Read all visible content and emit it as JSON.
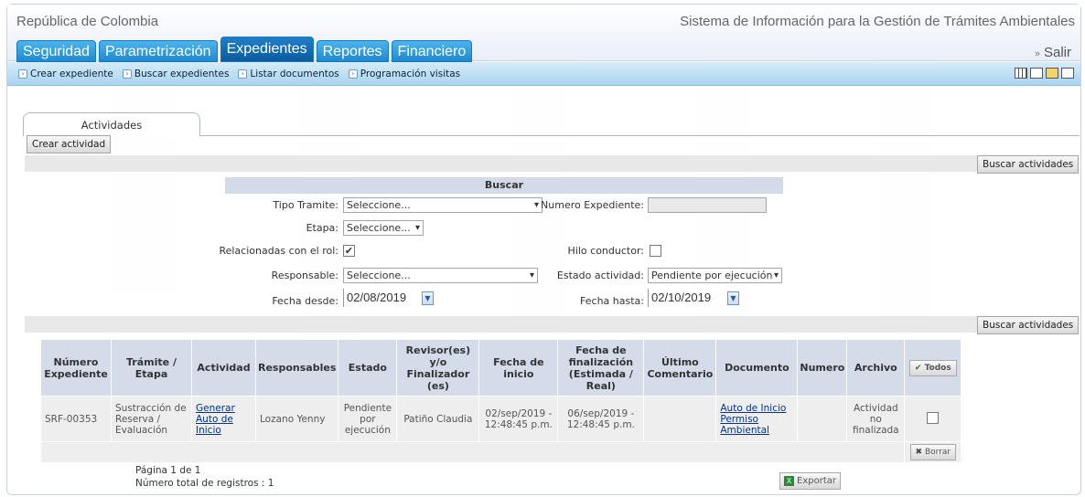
{
  "header": {
    "left_title": "República de Colombia",
    "right_title": "Sistema de Información para la Gestión de Trámites Ambientales",
    "logout": "Salir"
  },
  "tabs": [
    "Seguridad",
    "Parametrización",
    "Expedientes",
    "Reportes",
    "Financiero"
  ],
  "active_tab": "Expedientes",
  "submenu": [
    "Crear expediente",
    "Buscar expedientes",
    "Listar documentos",
    "Programación visitas"
  ],
  "toolbar_icons": [
    "table-icon",
    "mail-icon",
    "clipboard-icon",
    "document-icon"
  ],
  "activity_tab": "Actividades",
  "buttons": {
    "create_activity": "Crear actividad",
    "search_activities": "Buscar actividades",
    "all": "Todos",
    "delete": "Borrar",
    "export": "Exportar"
  },
  "search": {
    "title": "Buscar",
    "tipo_tramite_label": "Tipo Tramite:",
    "tipo_tramite_value": "Seleccione...",
    "numero_expediente_label": "Numero Expediente:",
    "numero_expediente_value": "",
    "etapa_label": "Etapa:",
    "etapa_value": "Seleccione...",
    "relacionadas_label": "Relacionadas con el rol:",
    "hilo_label": "Hilo conductor:",
    "responsable_label": "Responsable:",
    "responsable_value": "Seleccione...",
    "estado_label": "Estado actividad:",
    "estado_value": "Pendiente por ejecución",
    "fecha_desde_label": "Fecha desde:",
    "fecha_desde_value": "02/08/2019",
    "fecha_hasta_label": "Fecha hasta:",
    "fecha_hasta_value": "02/10/2019"
  },
  "table": {
    "headers": [
      "Número Expediente",
      "Trámite / Etapa",
      "Actividad",
      "Responsables",
      "Estado",
      "Revisor(es) y/o Finalizador (es)",
      "Fecha de inicio",
      "Fecha de finalización (Estimada / Real)",
      "Último Comentario",
      "Documento",
      "Numero",
      "Archivo"
    ],
    "rows": [
      {
        "numero": "SRF-00353",
        "tramite": "Sustracción de Reserva / Evaluación",
        "actividad": "Generar Auto de Inicio",
        "responsables": "Lozano Yenny",
        "estado": "Pendiente por ejecución",
        "revisor": "Patiño Claudia",
        "fecha_inicio": "02/sep/2019 - 12:48:45 p.m.",
        "fecha_fin": "06/sep/2019 - 12:48:45 p.m.",
        "comentario": "",
        "documento": "Auto de Inicio Permiso Ambiental",
        "numero_doc": "",
        "archivo": "Actividad no finalizada"
      }
    ]
  },
  "pager": {
    "page": "Página 1 de 1",
    "total": "Número total de registros : 1"
  }
}
